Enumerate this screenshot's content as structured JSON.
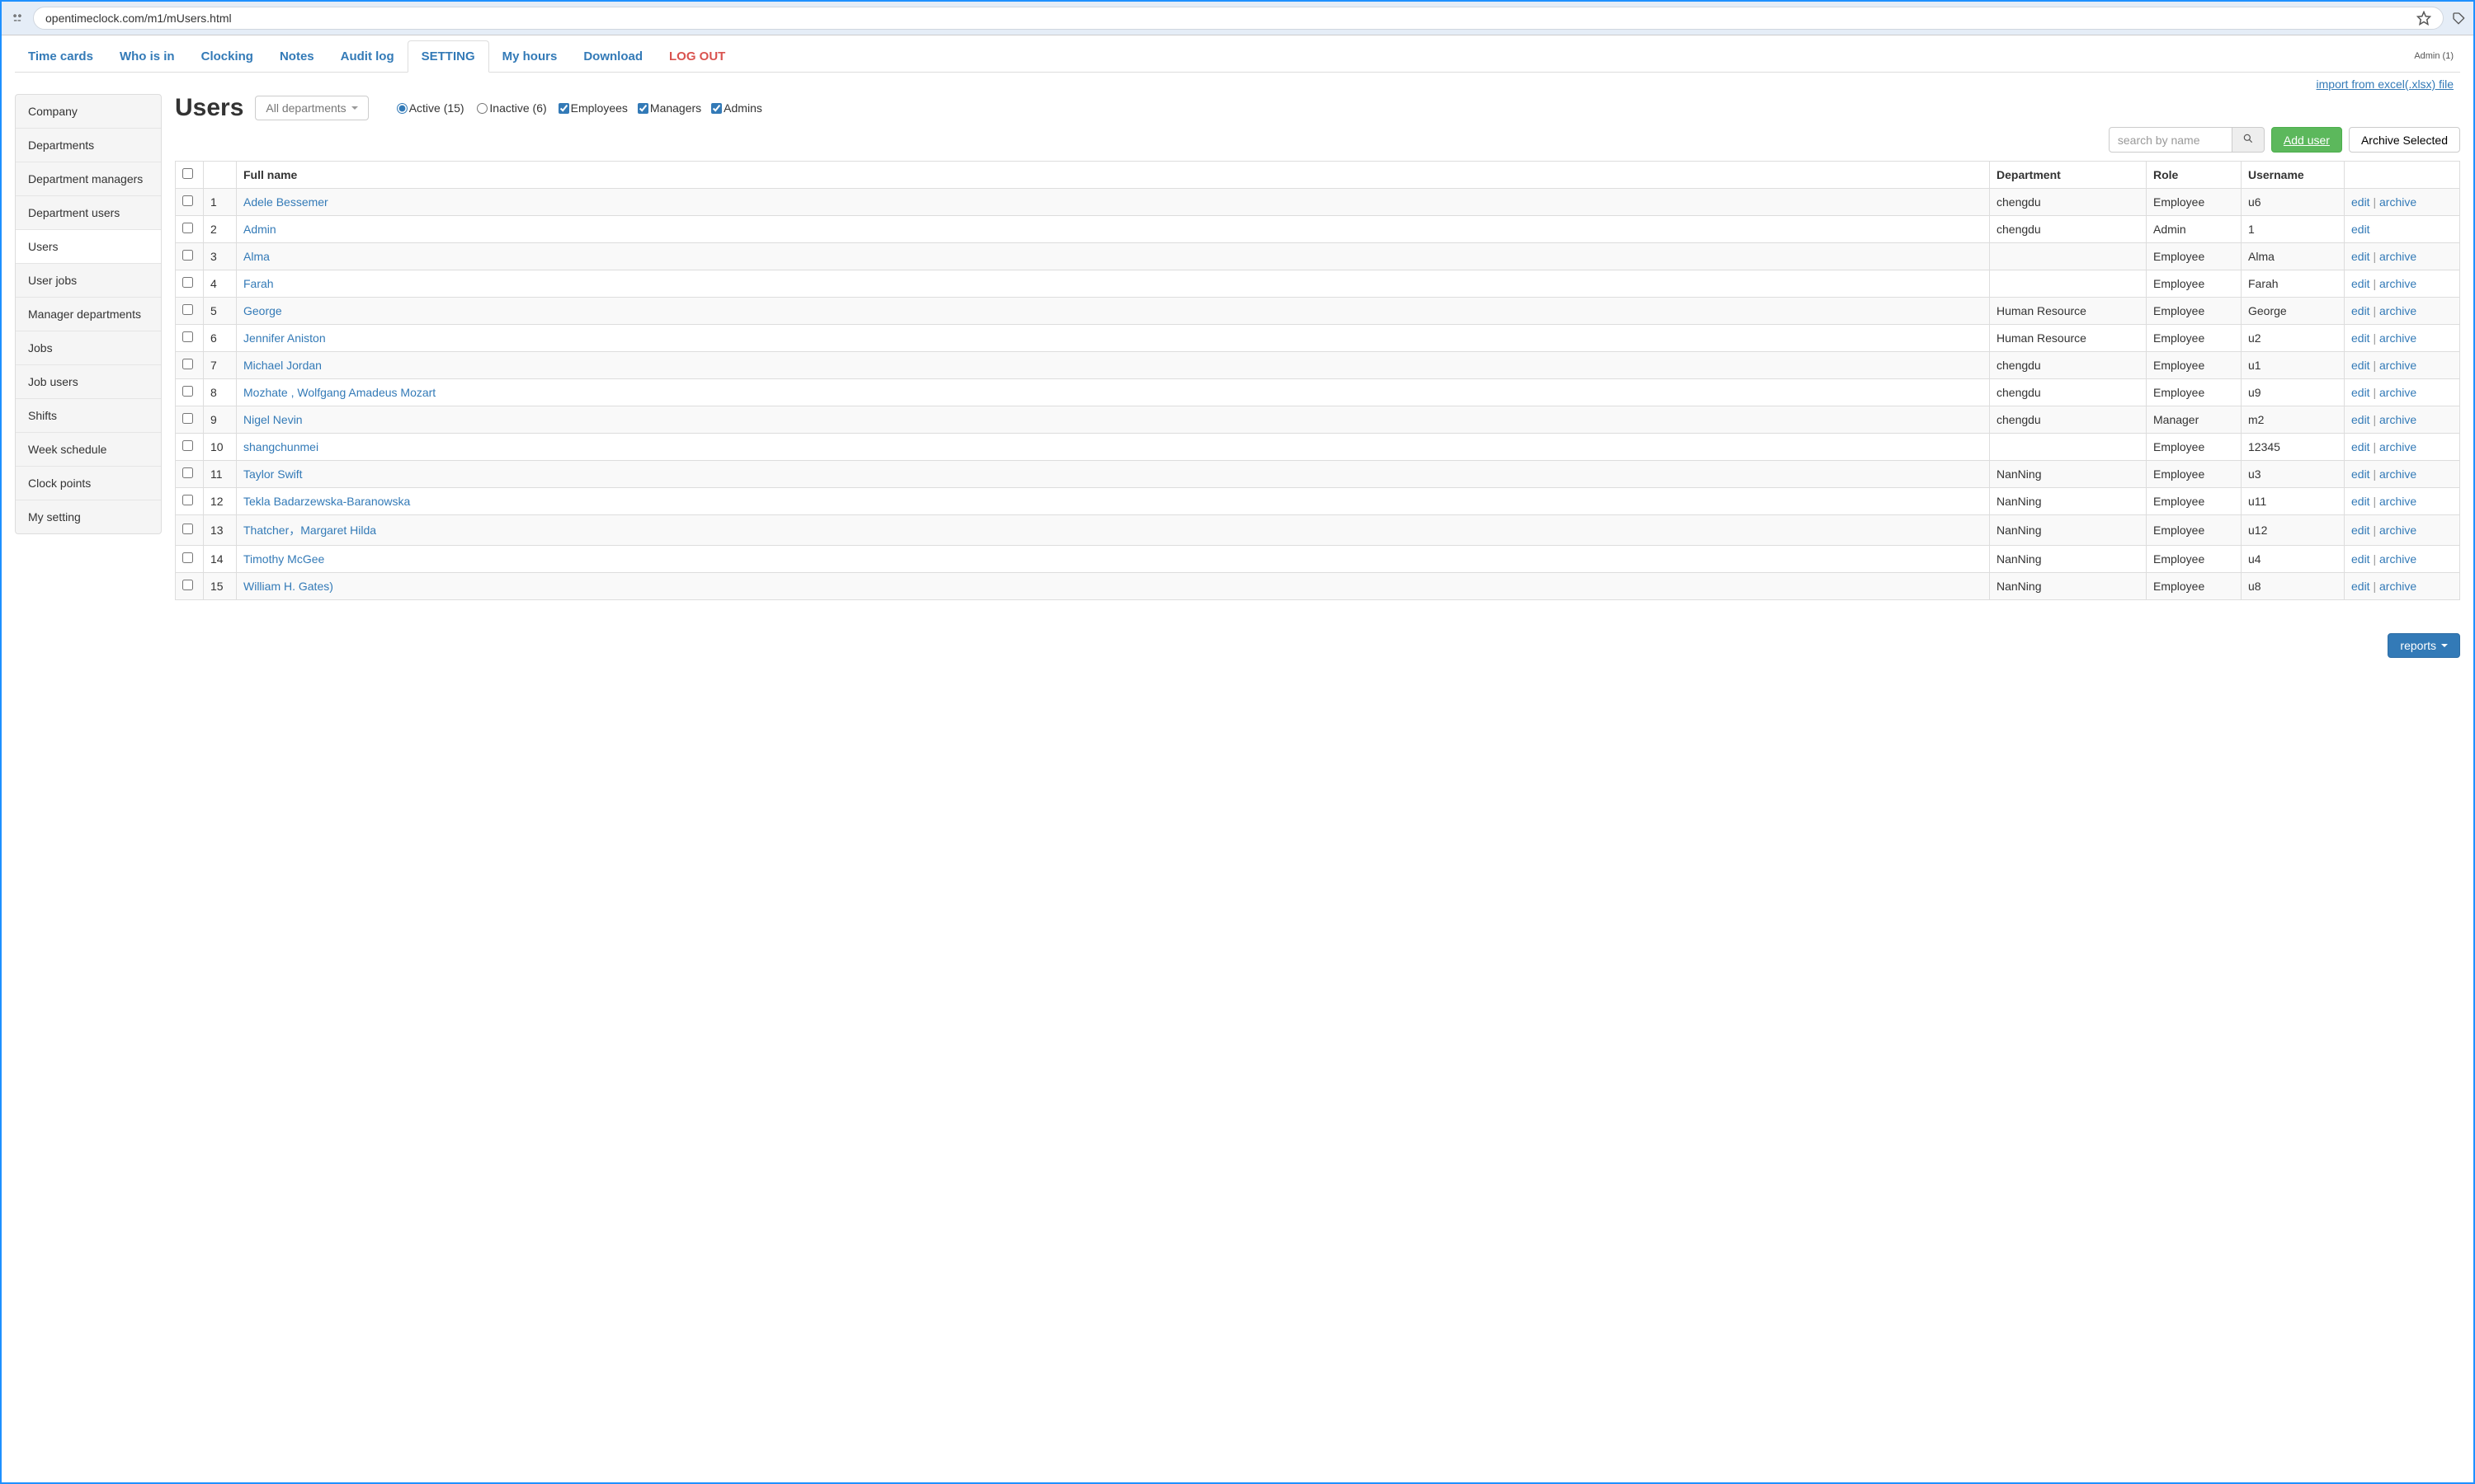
{
  "browser": {
    "url": "opentimeclock.com/m1/mUsers.html"
  },
  "admin_label": "Admin (1)",
  "nav": {
    "tabs": [
      {
        "label": "Time cards"
      },
      {
        "label": "Who is in"
      },
      {
        "label": "Clocking"
      },
      {
        "label": "Notes"
      },
      {
        "label": "Audit log"
      },
      {
        "label": "SETTING",
        "active": true
      },
      {
        "label": "My hours"
      },
      {
        "label": "Download"
      },
      {
        "label": "LOG OUT",
        "logout": true
      }
    ]
  },
  "import_link": "import from excel(.xlsx) file",
  "sidebar": {
    "items": [
      {
        "label": "Company"
      },
      {
        "label": "Departments"
      },
      {
        "label": "Department managers"
      },
      {
        "label": "Department users"
      },
      {
        "label": "Users",
        "active": true
      },
      {
        "label": "User jobs"
      },
      {
        "label": "Manager departments"
      },
      {
        "label": "Jobs"
      },
      {
        "label": "Job users"
      },
      {
        "label": "Shifts"
      },
      {
        "label": "Week schedule"
      },
      {
        "label": "Clock points"
      },
      {
        "label": "My setting"
      }
    ]
  },
  "page": {
    "title": "Users",
    "dept_filter": "All departments",
    "status": {
      "active": {
        "label": "Active (15)",
        "selected": true
      },
      "inactive": {
        "label": "Inactive (6)",
        "selected": false
      }
    },
    "role_filters": {
      "employees": {
        "label": "Employees",
        "checked": true
      },
      "managers": {
        "label": "Managers",
        "checked": true
      },
      "admins": {
        "label": "Admins",
        "checked": true
      }
    },
    "search_placeholder": "search by name",
    "add_user_label": "Add user",
    "archive_selected_label": "Archive Selected",
    "reports_label": "reports"
  },
  "table": {
    "headers": {
      "full_name": "Full name",
      "department": "Department",
      "role": "Role",
      "username": "Username"
    },
    "actions": {
      "edit": "edit",
      "archive": "archive"
    },
    "rows": [
      {
        "idx": "1",
        "name": "Adele Bessemer",
        "dept": "chengdu",
        "role": "Employee",
        "user": "u6",
        "archive": true
      },
      {
        "idx": "2",
        "name": "Admin",
        "dept": "chengdu",
        "role": "Admin",
        "user": "1",
        "archive": false
      },
      {
        "idx": "3",
        "name": "Alma",
        "dept": "",
        "role": "Employee",
        "user": "Alma",
        "archive": true
      },
      {
        "idx": "4",
        "name": "Farah",
        "dept": "",
        "role": "Employee",
        "user": "Farah",
        "archive": true
      },
      {
        "idx": "5",
        "name": "George",
        "dept": "Human Resource",
        "role": "Employee",
        "user": "George",
        "archive": true
      },
      {
        "idx": "6",
        "name": "Jennifer Aniston",
        "dept": "Human Resource",
        "role": "Employee",
        "user": "u2",
        "archive": true
      },
      {
        "idx": "7",
        "name": "Michael Jordan",
        "dept": "chengdu",
        "role": "Employee",
        "user": "u1",
        "archive": true
      },
      {
        "idx": "8",
        "name": "Mozhate , Wolfgang Amadeus Mozart",
        "dept": "chengdu",
        "role": "Employee",
        "user": "u9",
        "archive": true
      },
      {
        "idx": "9",
        "name": "Nigel Nevin",
        "dept": "chengdu",
        "role": "Manager",
        "user": "m2",
        "archive": true
      },
      {
        "idx": "10",
        "name": "shangchunmei",
        "dept": "",
        "role": "Employee",
        "user": "12345",
        "archive": true
      },
      {
        "idx": "11",
        "name": "Taylor Swift",
        "dept": "NanNing",
        "role": "Employee",
        "user": "u3",
        "archive": true
      },
      {
        "idx": "12",
        "name": "Tekla Badarzewska-Baranowska",
        "dept": "NanNing",
        "role": "Employee",
        "user": "u11",
        "archive": true
      },
      {
        "idx": "13",
        "name": "Thatcher，Margaret Hilda",
        "dept": "NanNing",
        "role": "Employee",
        "user": "u12",
        "archive": true
      },
      {
        "idx": "14",
        "name": "Timothy McGee",
        "dept": "NanNing",
        "role": "Employee",
        "user": "u4",
        "archive": true
      },
      {
        "idx": "15",
        "name": "William H. Gates)",
        "dept": "NanNing",
        "role": "Employee",
        "user": "u8",
        "archive": true
      }
    ]
  }
}
